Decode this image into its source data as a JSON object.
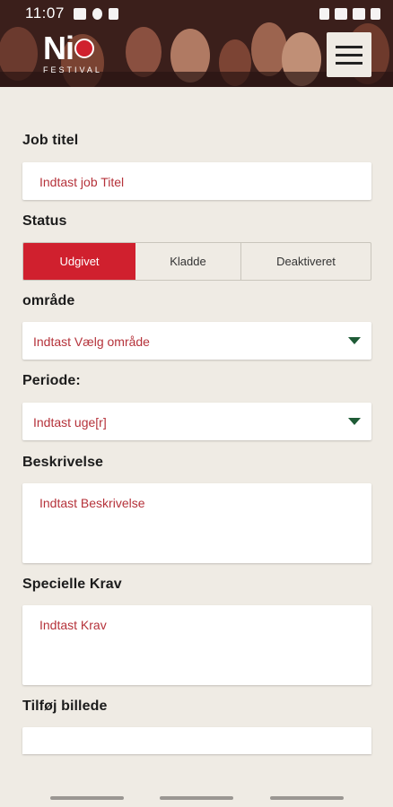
{
  "status_bar": {
    "time": "11:07"
  },
  "header": {
    "logo_text": "Ni",
    "logo_sub": "FESTIVAL"
  },
  "form": {
    "job_title": {
      "label": "Job titel",
      "placeholder": "Indtast job Titel"
    },
    "status": {
      "label": "Status",
      "options": [
        "Udgivet",
        "Kladde",
        "Deaktiveret"
      ],
      "selected": "Udgivet"
    },
    "area": {
      "label": "område",
      "placeholder": "Indtast Vælg område"
    },
    "period": {
      "label": "Periode:",
      "placeholder": "Indtast uge[r]"
    },
    "description": {
      "label": "Beskrivelse",
      "placeholder": "Indtast Beskrivelse"
    },
    "special": {
      "label": "Specielle Krav",
      "placeholder": "Indtast Krav"
    },
    "image": {
      "label": "Tilføj billede"
    }
  },
  "colors": {
    "accent": "#d0202e",
    "placeholder": "#b5323a",
    "caret": "#1e5b36",
    "background": "#efebe4"
  }
}
